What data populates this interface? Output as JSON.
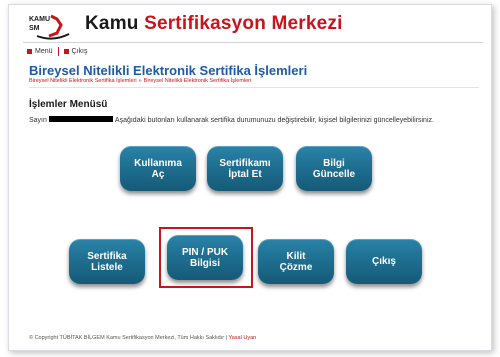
{
  "header": {
    "logo_text": "KAMU SM",
    "brand_kamu": "Kamu",
    "brand_rest": "Sertifikasyon Merkezi"
  },
  "nav": {
    "menu_label": "Menü",
    "logout_label": "Çıkış"
  },
  "page": {
    "title": "Bireysel Nitelikli Elektronik Sertifika İşlemleri",
    "breadcrumb": [
      "Bireysel Nitelikli Elektronik Sertifika İşlemleri",
      "Bireysel Nitelikli Elektronik Sertifika İşlemleri"
    ],
    "menu_heading": "İşlemler Menüsü",
    "intro_prefix": "Sayın",
    "intro_text": "Aşağıdaki butonları kullanarak sertifika durumunuzu değiştirebilir, kişisel bilgilerinizi güncelleyebilirsiniz."
  },
  "buttons": [
    {
      "id": "kullanima-ac",
      "label": "Kullanıma\nAç"
    },
    {
      "id": "sertifikami-iptal-et",
      "label": "Sertifikamı\nİptal Et"
    },
    {
      "id": "bilgi-guncelle",
      "label": "Bilgi\nGüncelle"
    },
    {
      "id": "sertifika-listele",
      "label": "Sertifika\nListele"
    },
    {
      "id": "pin-puk-bilgisi",
      "label": "PIN / PUK\nBilgisi",
      "highlighted": true
    },
    {
      "id": "kilit-cozme",
      "label": "Kilit\nÇözme"
    },
    {
      "id": "cikis",
      "label": "Çıkış"
    }
  ],
  "footer": {
    "copyright": "© Copyright TÜBİTAK BİLGEM Kamu Sertifikasyon Merkezi, Tüm Hakkı Saklıdır |",
    "legal_link": "Yasal Uyarı"
  },
  "colors": {
    "brand_red": "#c8141b",
    "title_blue": "#1f5aa8",
    "button_teal": "#1f6f91"
  }
}
